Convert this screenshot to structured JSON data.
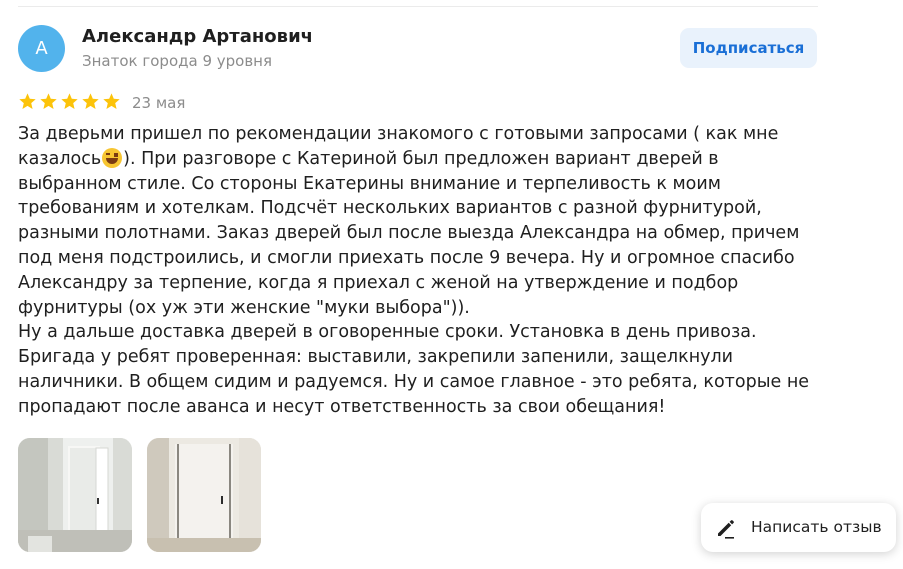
{
  "author": {
    "avatar_letter": "А",
    "name": "Александр Артанович",
    "level": "Знаток города 9 уровня"
  },
  "subscribe_label": "Подписаться",
  "rating": {
    "stars": 5,
    "max": 5,
    "color": "#fcc30a"
  },
  "date": "23 мая",
  "text_lines": [
    "За дверьми пришел по рекомендации знакомого с готовыми запросами ( как мне",
    "казалось",
    "). При разговоре с Катериной был предложен вариант дверей в",
    "выбранном стиле. Со стороны Екатерины внимание и терпеливость к моим",
    "требованиям и хотелкам. Подсчёт нескольких вариантов с разной фурнитурой,",
    "разными полотнами. Заказ дверей был после выезда Александра на обмер, причем",
    "под меня подстроились, и смогли приехать после 9 вечера. Ну и огромное спасибо",
    "Александру за терпение, когда я приехал с женой на утверждение и подбор",
    "фурнитуры (ох уж эти женские \"муки выбора\")).",
    "Ну а дальше доставка дверей в оговоренные сроки. Установка в день привоза.",
    "Бригада у ребят проверенная: выставили, закрепили запенили, защелкнули",
    "наличники. В общем сидим и радуемся. Ну и самое главное - это ребята, которые не",
    "пропадают после аванса и несут ответственность за свои обещания!"
  ],
  "photos": [
    {
      "icon": "door-photo-open"
    },
    {
      "icon": "door-photo-closed"
    }
  ],
  "write_review_label": "Написать отзыв",
  "colors": {
    "avatar": "#52b3ec",
    "subscribe_bg": "#e9f2fc",
    "subscribe_text": "#1a6fd6",
    "muted_text": "#8c8c8c"
  }
}
